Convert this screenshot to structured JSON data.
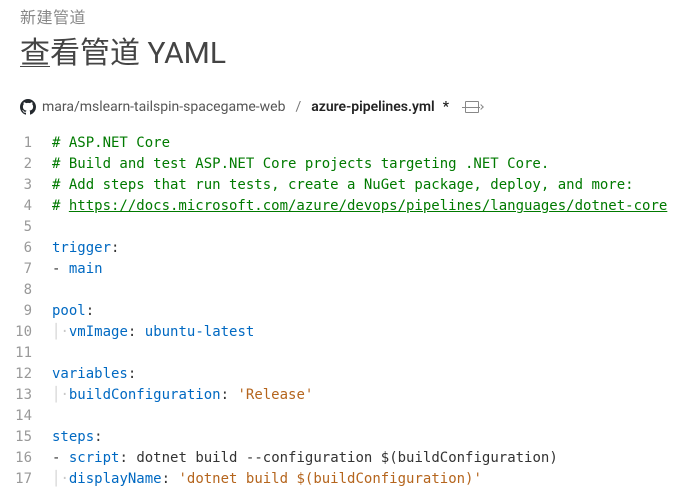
{
  "top_label": "新建管道",
  "page_title_first": "查",
  "page_title_rest": "看管道 YAML",
  "breadcrumb": {
    "repo": "mara/mslearn-tailspin-spacegame-web",
    "sep": "/",
    "file": "azure-pipelines.yml",
    "dirty": "*"
  },
  "lines": {
    "l1_comment": "# ASP.NET Core",
    "l2_comment": "# Build and test ASP.NET Core projects targeting .NET Core.",
    "l3_comment": "# Add steps that run tests, create a NuGet package, deploy, and more:",
    "l4_prefix": "# ",
    "l4_link": "https://docs.microsoft.com/azure/devops/pipelines/languages/dotnet-core",
    "l6_key": "trigger",
    "l7_item": "main",
    "l9_key": "pool",
    "l10_key": "vmImage",
    "l10_val": "ubuntu-latest",
    "l12_key": "variables",
    "l13_key": "buildConfiguration",
    "l13_val": "'Release'",
    "l15_key": "steps",
    "l16_key": "script",
    "l16_val": "dotnet build --configuration $(buildConfiguration)",
    "l17_key": "displayName",
    "l17_val": "'dotnet build $(buildConfiguration)'"
  },
  "gutter": {
    "n1": "1",
    "n2": "2",
    "n3": "3",
    "n4": "4",
    "n5": "5",
    "n6": "6",
    "n7": "7",
    "n8": "8",
    "n9": "9",
    "n10": "10",
    "n11": "11",
    "n12": "12",
    "n13": "13",
    "n14": "14",
    "n15": "15",
    "n16": "16",
    "n17": "17"
  }
}
